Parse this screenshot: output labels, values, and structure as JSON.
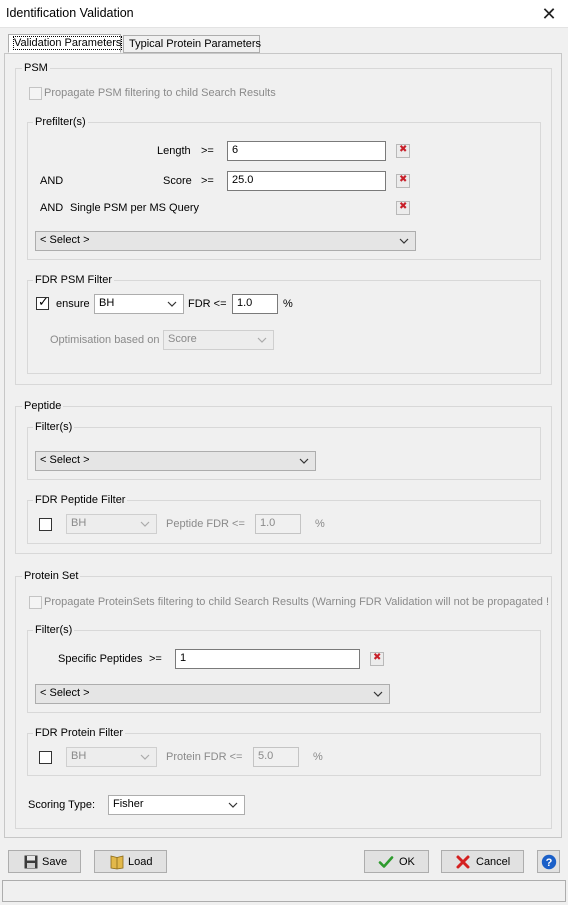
{
  "window": {
    "title": "Identification Validation",
    "close_glyph": "✕"
  },
  "tabs": [
    {
      "label": "Validation Parameters",
      "active": true
    },
    {
      "label": "Typical Protein Parameters",
      "active": false
    }
  ],
  "psm": {
    "label": "PSM",
    "propagate_label": "Propagate PSM filtering to child Search Results",
    "propagate_checked": false,
    "prefilter": {
      "label": "Prefilter(s)",
      "rows": [
        {
          "connector": "",
          "name": "Length",
          "op": ">=",
          "value": "6"
        },
        {
          "connector": "AND",
          "name": "Score",
          "op": ">=",
          "value": "25.0"
        },
        {
          "connector": "AND",
          "name": "Single PSM per MS Query"
        }
      ],
      "select_placeholder": "< Select >"
    },
    "fdr": {
      "label": "FDR PSM Filter",
      "checked": true,
      "ensure_label": "ensure",
      "method": "BH",
      "fdr_label": "FDR <=",
      "fdr_value": "1.0",
      "unit": "%",
      "optimisation_label": "Optimisation based on",
      "optimisation_value": "Score"
    }
  },
  "peptide": {
    "label": "Peptide",
    "filters": {
      "label": "Filter(s)",
      "select_placeholder": "< Select >"
    },
    "fdr": {
      "label": "FDR Peptide Filter",
      "checked": false,
      "method": "BH",
      "fdr_label": "Peptide FDR <=",
      "fdr_value": "1.0",
      "unit": "%"
    }
  },
  "protein_set": {
    "label": "Protein Set",
    "propagate_label": "Propagate ProteinSets filtering to child Search Results (Warning FDR Validation will not be propagated !",
    "propagate_checked": false,
    "filters": {
      "label": "Filter(s)",
      "rows": [
        {
          "name": "Specific Peptides",
          "op": ">=",
          "value": "1"
        }
      ],
      "select_placeholder": "< Select >"
    },
    "fdr": {
      "label": "FDR Protein Filter",
      "checked": false,
      "method": "BH",
      "fdr_label": "Protein FDR <=",
      "fdr_value": "5.0",
      "unit": "%"
    },
    "scoring_label": "Scoring Type:",
    "scoring_value": "Fisher"
  },
  "buttons": {
    "save": "Save",
    "load": "Load",
    "ok": "OK",
    "cancel": "Cancel",
    "help_icon": "help-icon"
  },
  "colors": {
    "delete_red": "#c8202a",
    "ok_green": "#2e9b2e",
    "cancel_red": "#d42020",
    "help_blue": "#1a5fc8"
  }
}
